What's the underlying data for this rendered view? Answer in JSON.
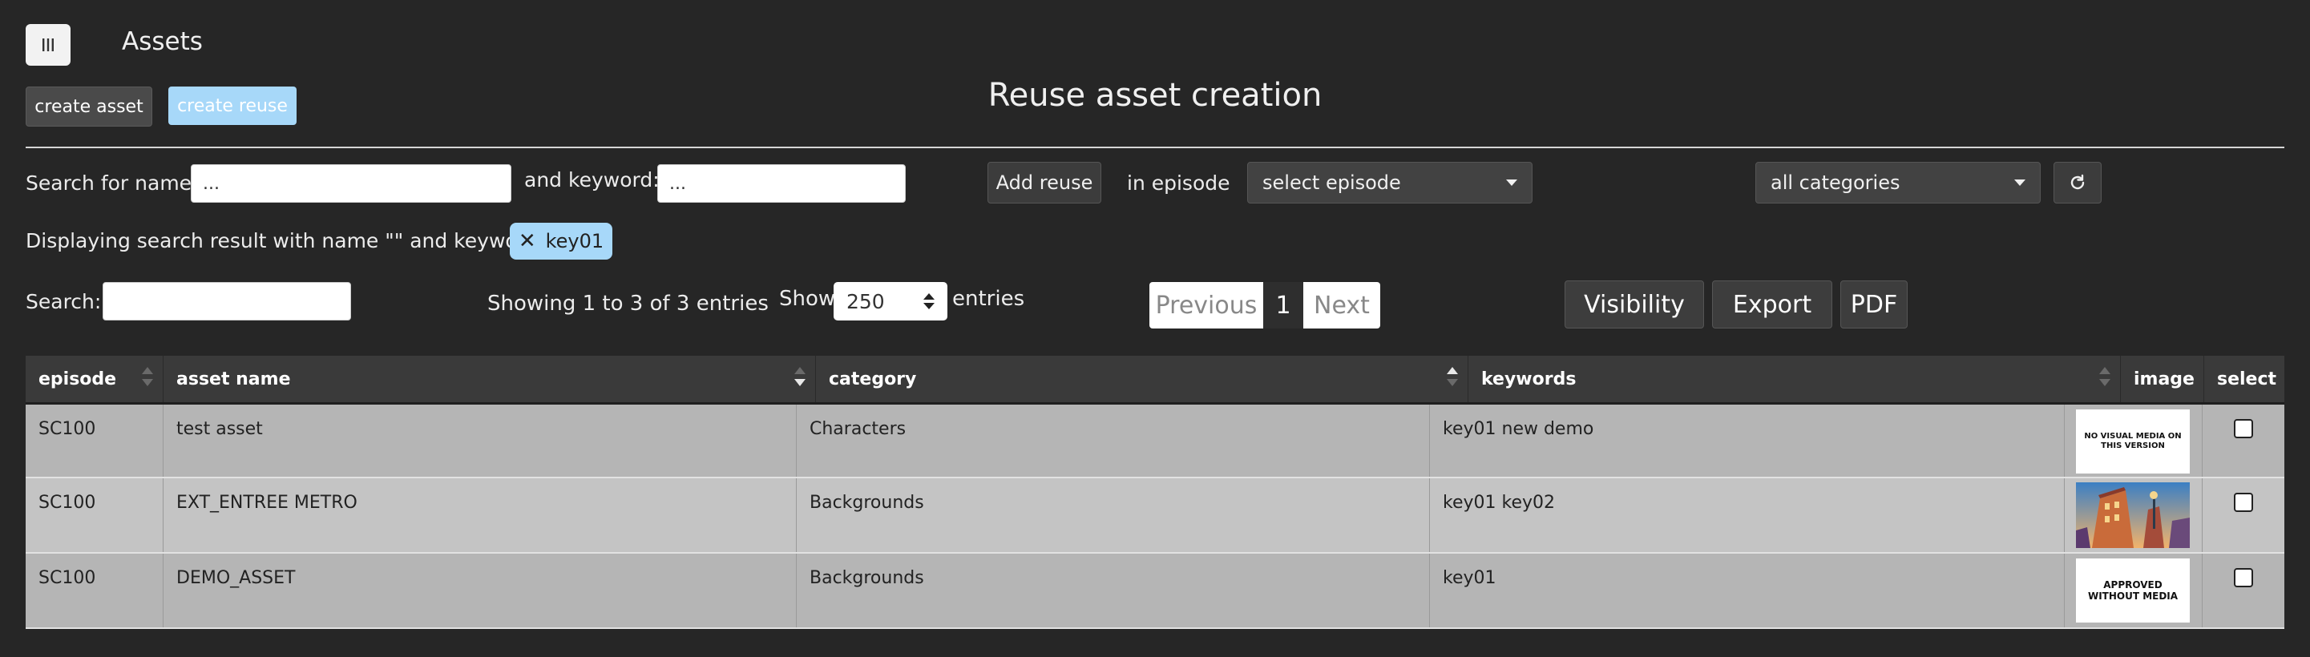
{
  "header": {
    "menu_icon": "menu-bars-icon",
    "app_title": "Assets",
    "create_asset_label": "create asset",
    "create_reuse_label": "create reuse",
    "page_title": "Reuse asset creation"
  },
  "search_bar": {
    "name_label": "Search for name:",
    "name_value": "...",
    "keyword_label": "and keyword:",
    "keyword_value": "...",
    "add_reuse_label": "Add reuse",
    "in_episode_label": "in episode",
    "episode_select_value": "select episode",
    "category_select_value": "all categories",
    "reset_icon": "reset-icon"
  },
  "filter_summary": {
    "text": "Displaying search result with name \"\" and keywords:",
    "chip_label": "key01",
    "chip_icon": "close-icon"
  },
  "table_controls": {
    "search_label": "Search:",
    "search_value": "",
    "info_text": "Showing 1 to 3 of 3 entries",
    "show_label": "Show",
    "page_length": "250",
    "entries_label": "entries",
    "prev_label": "Previous",
    "current_page": "1",
    "next_label": "Next",
    "visibility_label": "Visibility",
    "export_label": "Export",
    "pdf_label": "PDF"
  },
  "table": {
    "columns": [
      "episode",
      "asset name",
      "category",
      "keywords",
      "image",
      "select"
    ],
    "rows": [
      {
        "episode": "SC100",
        "asset_name": "test asset",
        "category": "Characters",
        "keywords": "key01 new demo",
        "image_text": "NO VISUAL MEDIA ON THIS VERSION",
        "row_bg": "#b5b5b5"
      },
      {
        "episode": "SC100",
        "asset_name": "EXT_ENTREE METRO",
        "category": "Backgrounds",
        "keywords": "key01 key02",
        "image_text": "",
        "row_bg": "#c4c4c4"
      },
      {
        "episode": "SC100",
        "asset_name": "DEMO_ASSET",
        "category": "Backgrounds",
        "keywords": "key01",
        "image_text": "APPROVED WITHOUT MEDIA",
        "row_bg": "#b5b5b5"
      }
    ]
  },
  "colors": {
    "background": "#262626",
    "accent": "#a7d8f9",
    "header_bg": "#3a3a3a"
  }
}
